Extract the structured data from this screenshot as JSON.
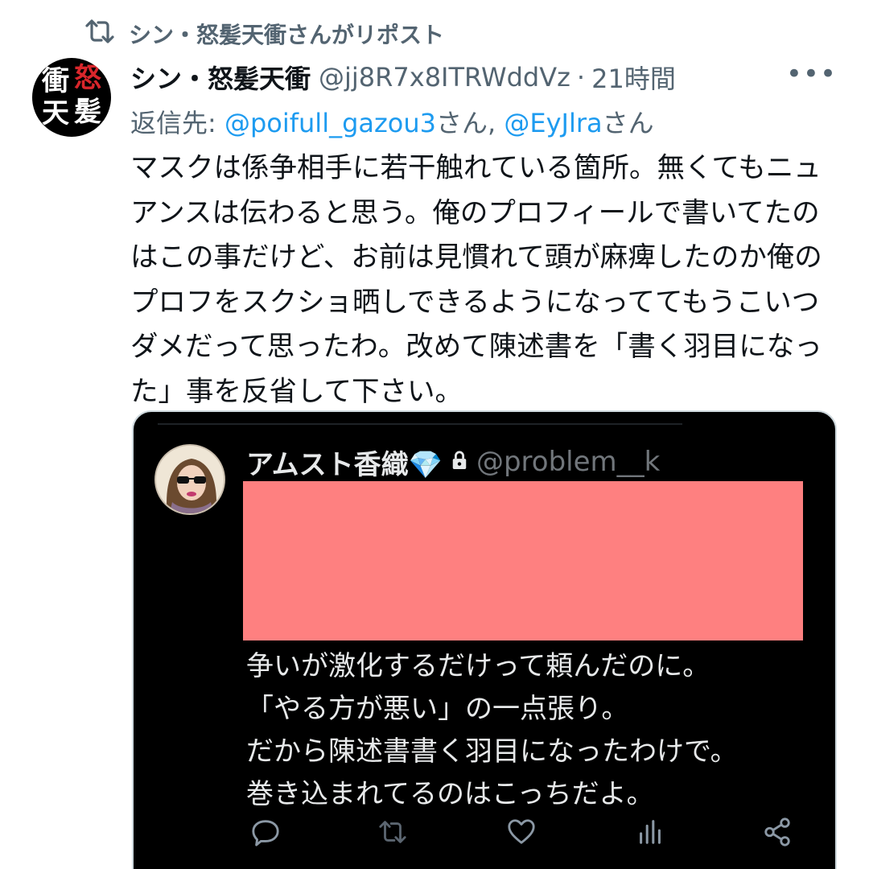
{
  "retweet": {
    "label": "シン・怒髪天衝さんがリポスト",
    "icon": "retweet-icon"
  },
  "tweet": {
    "avatar_text": [
      "衝",
      "怒",
      "天",
      "髪"
    ],
    "author_name": "シン・怒髪天衝",
    "handle": "@jj8R7x8ITRWddVz",
    "separator": "·",
    "time": "21時間",
    "more_label": "•••",
    "reply": {
      "prefix": "返信先: ",
      "mention1": "@poifull_gazou3",
      "suffix1": "さん, ",
      "mention2": "@EyJlra",
      "suffix2": "さん"
    },
    "text_lines": [
      "マスクは係争相手に若干触れている箇所。無くてもニュ",
      "アンスは伝わると思う。俺のプロフィールで書いてたの",
      "はこの事だけど、お前は見慣れて頭が麻痺したのか俺の",
      "プロフをスクショ晒しできるようになっててもうこいつ",
      "ダメだって思ったわ。改めて陳述書を「書く羽目になっ",
      "た」事を反省して下さい。"
    ]
  },
  "quoted": {
    "author_name": "アムスト香織💎",
    "lock_icon": "lock-icon",
    "handle": "@problem__k",
    "redaction_color": "#fe8080",
    "text_lines": [
      "争いが激化するだけって頼んだのに。",
      "「やる方が悪い」の一点張り。",
      "だから陳述書書く羽目になったわけで。",
      "巻き込まれてるのはこっちだよ。"
    ],
    "actions": [
      "reply-icon",
      "retweet-icon",
      "like-icon",
      "analytics-icon",
      "share-icon"
    ]
  },
  "colors": {
    "link": "#1d9bf0",
    "secondary": "#536471",
    "avatar_red": "#d9262b"
  }
}
